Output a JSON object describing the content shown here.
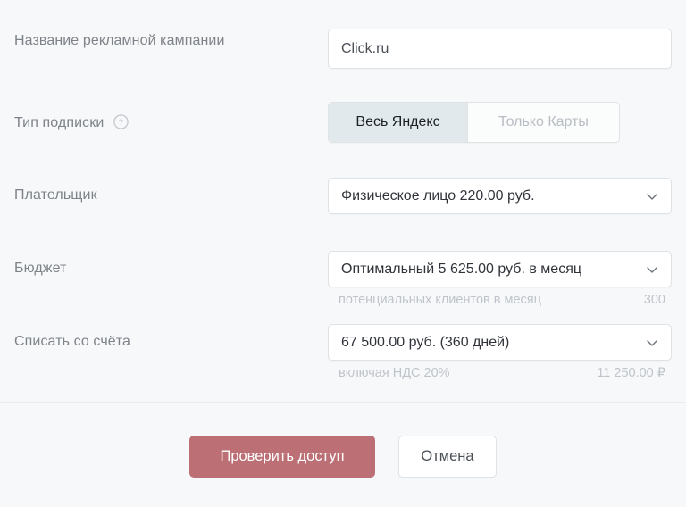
{
  "form": {
    "rows": [
      {
        "label": "Название рекламной кампании",
        "value": "Click.ru"
      },
      {
        "label": "Тип подписки",
        "help_icon": "question-circle-icon",
        "options": [
          {
            "label": "Весь Яндекс",
            "selected": true
          },
          {
            "label": "Только Карты",
            "selected": false
          }
        ]
      },
      {
        "label": "Плательщик",
        "value": "Физическое лицо 220.00 руб.",
        "chevron_icon": "chevron-down-icon"
      },
      {
        "label": "Бюджет",
        "value": "Оптимальный 5 625.00 руб. в месяц",
        "chevron_icon": "chevron-down-icon",
        "hint_text": "потенциальных клиентов в месяц",
        "hint_value": "300"
      },
      {
        "label": "Списать со счёта",
        "value": "67 500.00 руб. (360 дней)",
        "chevron_icon": "chevron-down-icon",
        "hint_text": "включая НДС 20%",
        "hint_value": "11 250.00 ₽"
      }
    ]
  },
  "footer": {
    "submit_label": "Проверить доступ",
    "cancel_label": "Отмена"
  },
  "colors": {
    "page_background": "#f7f8f9",
    "primary_button": "#bc6f74",
    "segment_active": "#e2e9ed",
    "border": "#dfe3e6",
    "label_text": "#7e8389",
    "hint_text": "#bfc4ca"
  }
}
